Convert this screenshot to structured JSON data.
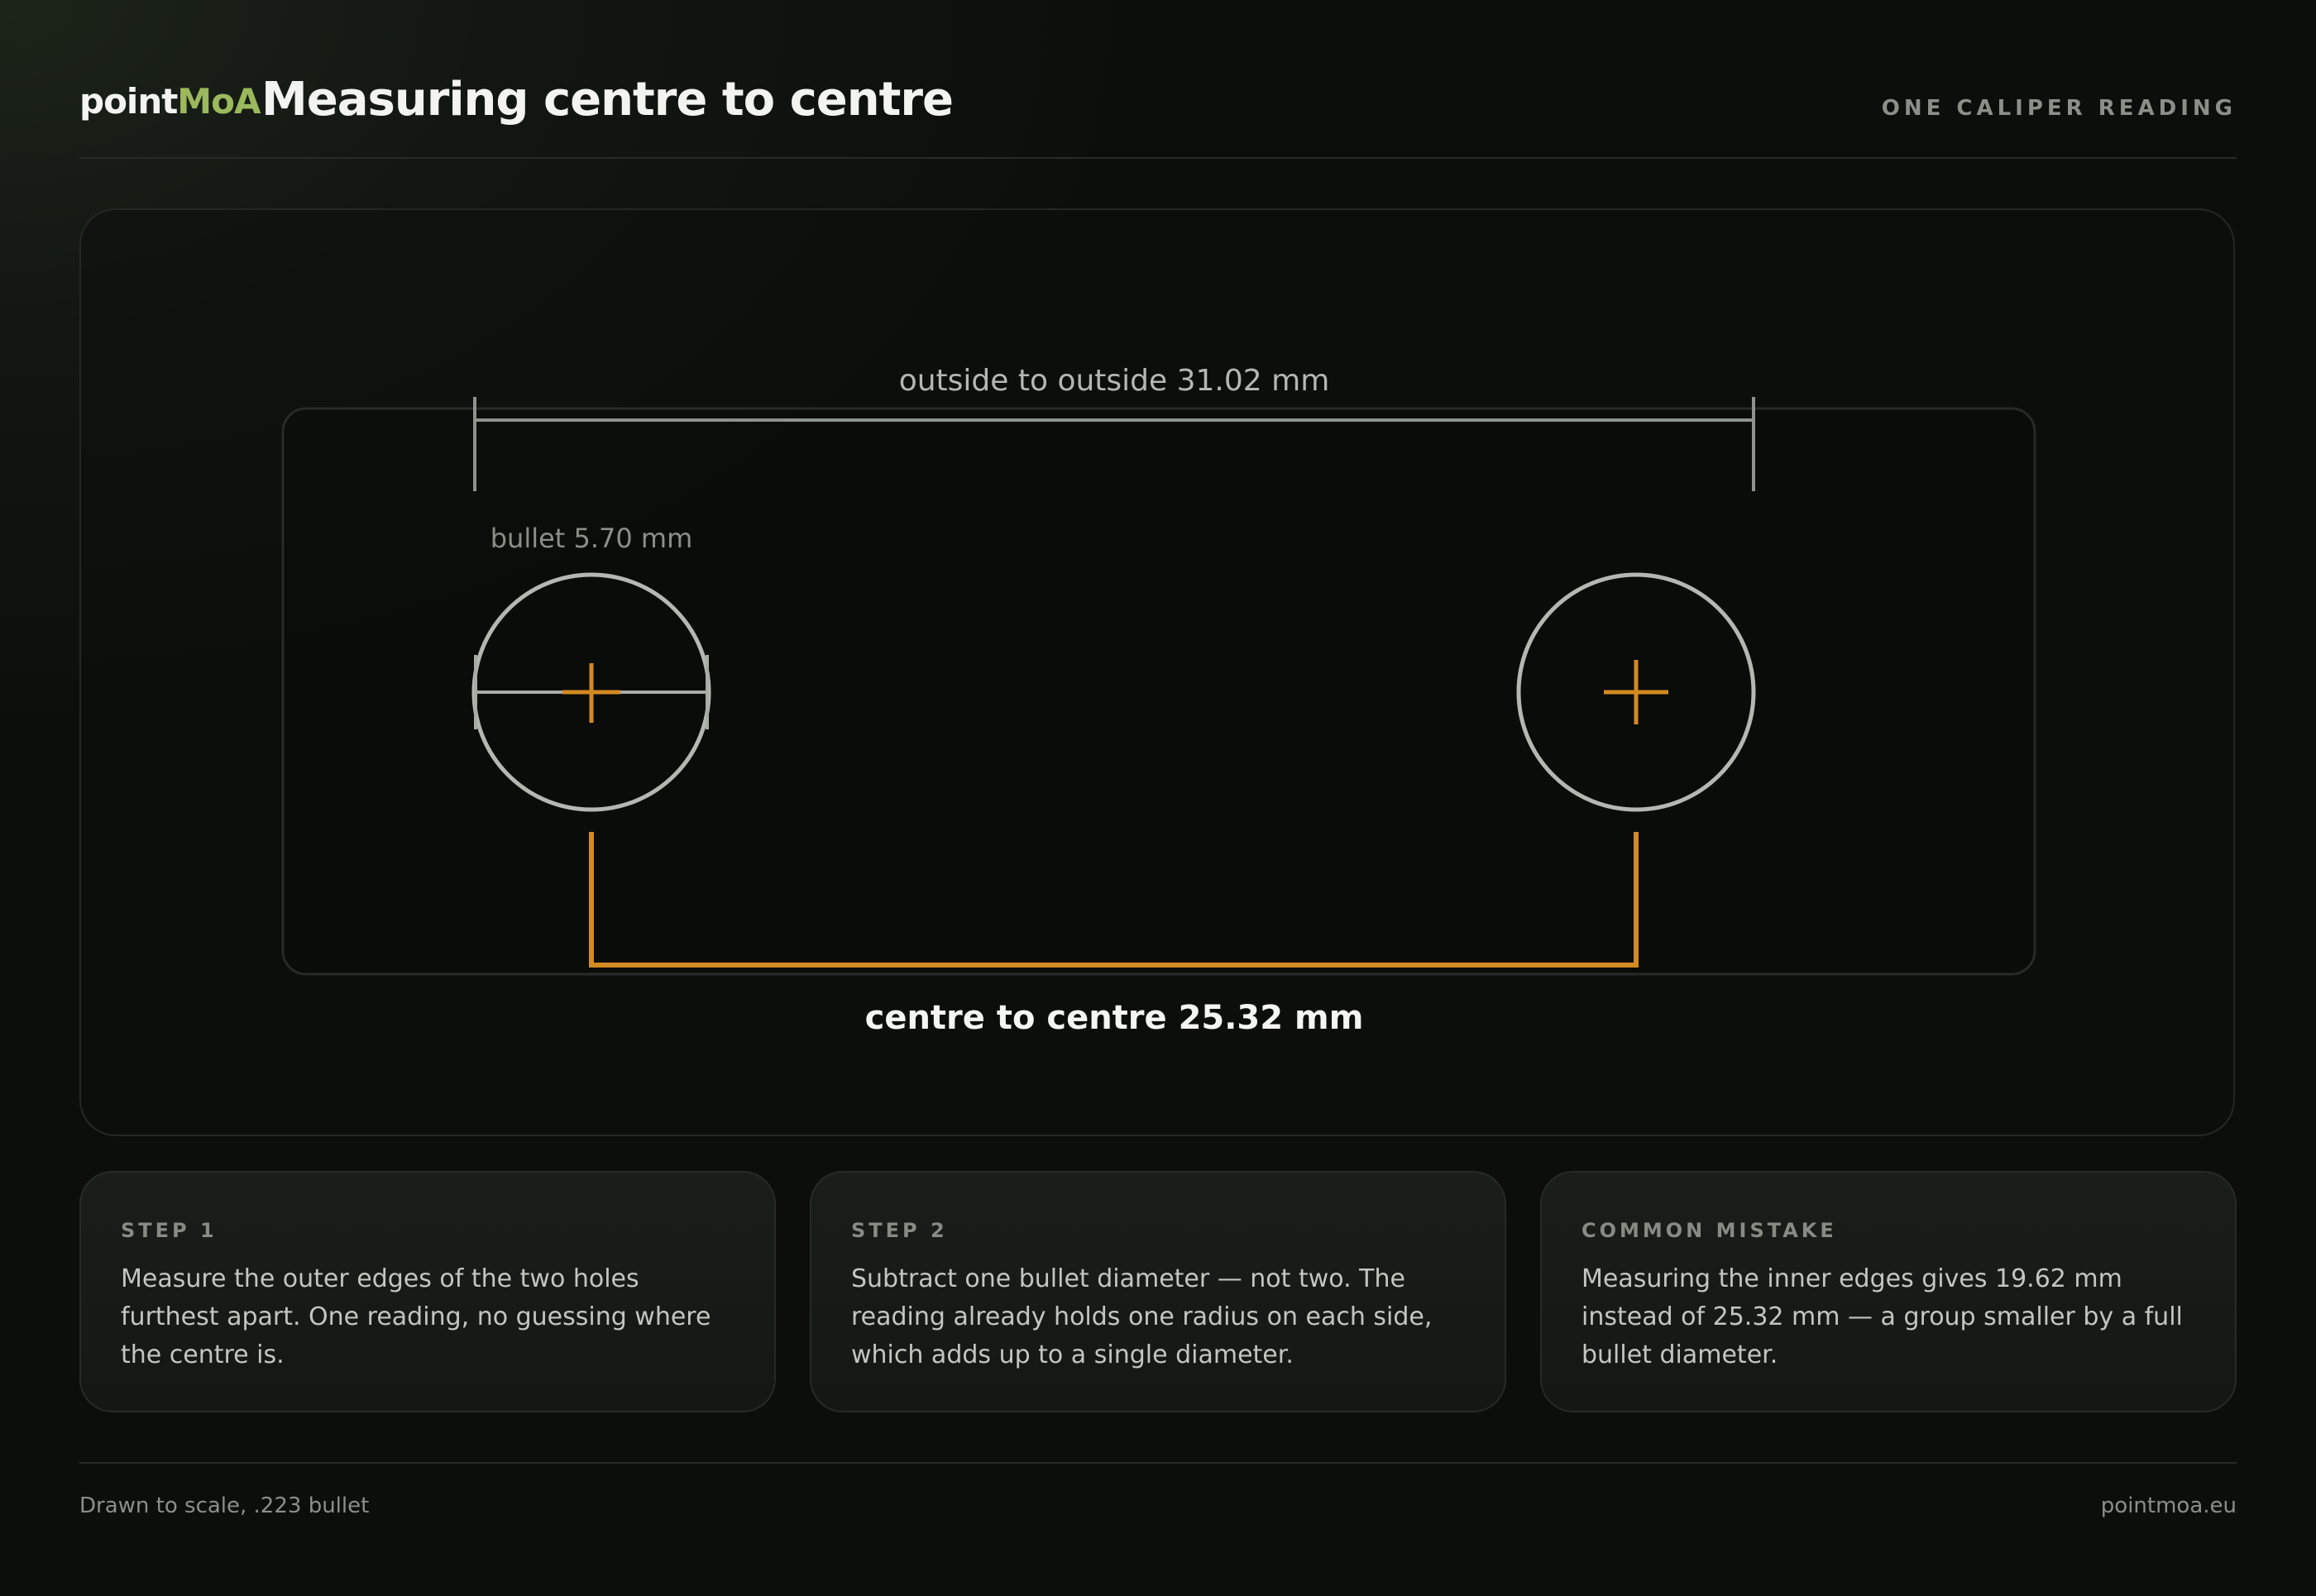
{
  "header": {
    "brand_prefix": "point",
    "brand_accent": "MoA",
    "title": "Measuring centre to centre",
    "tag": "ONE CALIPER READING"
  },
  "diagram": {
    "outside_label": "outside to outside 31.02 mm",
    "bullet_label": "bullet 5.70 mm",
    "centre_label": "centre to centre 25.32 mm",
    "measurements_mm": {
      "outside_to_outside": 31.02,
      "bullet_diameter": 5.7,
      "centre_to_centre": 25.32
    }
  },
  "steps": [
    {
      "label": "STEP 1",
      "text": "Measure the outer edges of the two holes furthest apart. One reading, no guessing where the centre is."
    },
    {
      "label": "STEP 2",
      "text": "Subtract one bullet diameter — not two. The reading already holds one radius on each side, which adds up to a single diameter."
    },
    {
      "label": "COMMON MISTAKE",
      "text": "Measuring the inner edges gives 19.62 mm instead of 25.32 mm — a group smaller by a full bullet diameter."
    }
  ],
  "footer": {
    "note": "Drawn to scale, .223 bullet",
    "site": "pointmoa.eu"
  },
  "colors": {
    "accent_orange": "#d48a22",
    "brand_green": "#9bb85c",
    "hole_stroke": "#b3b8b1",
    "measure_gray": "#8e938c"
  }
}
